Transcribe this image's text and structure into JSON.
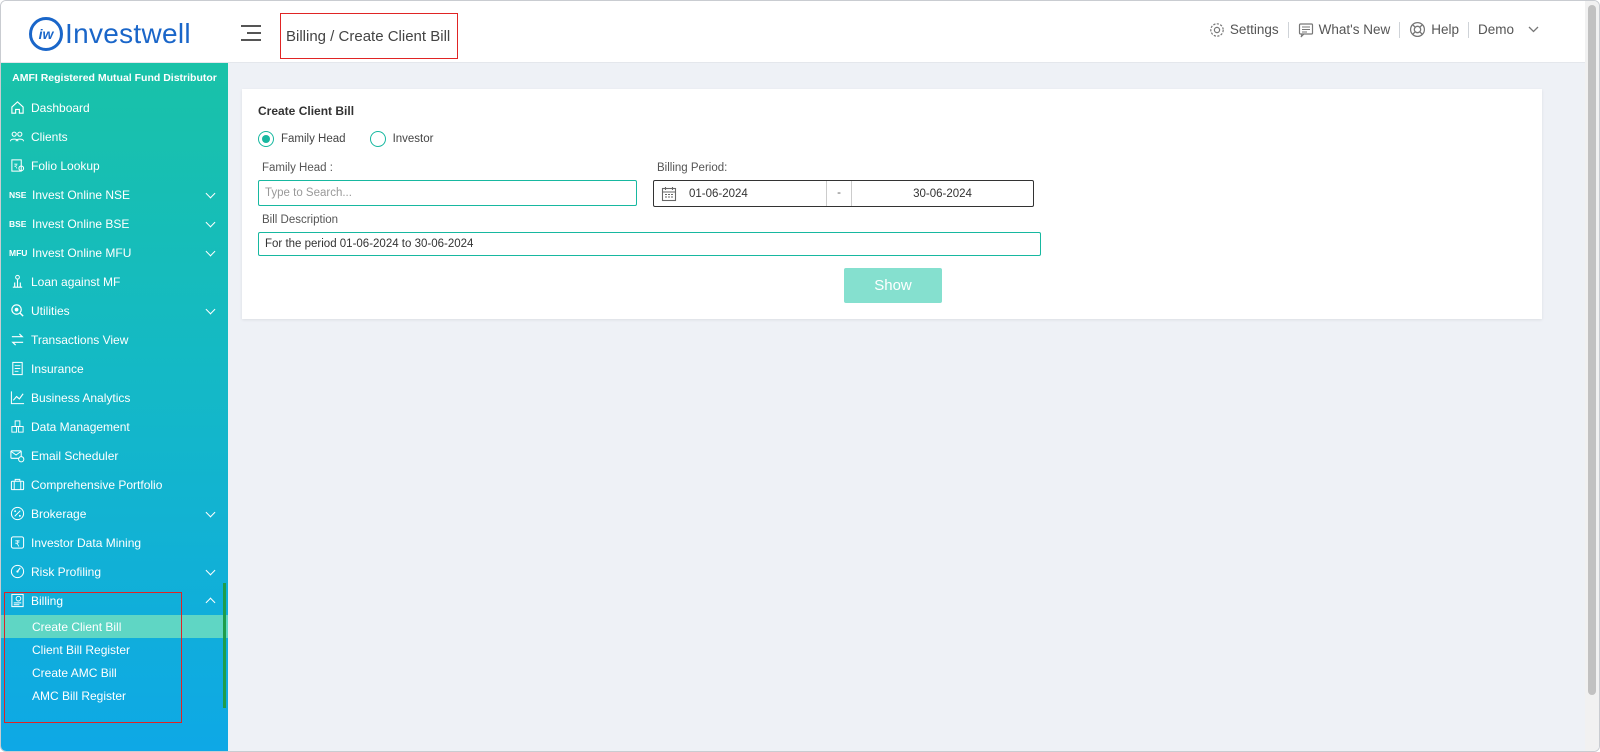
{
  "header": {
    "logo_text": "Investwell",
    "logo_mark": "iw",
    "breadcrumb": "Billing / Create Client Bill",
    "settings_label": "Settings",
    "whats_new_label": "What's New",
    "help_label": "Help",
    "user_label": "Demo"
  },
  "sidebar": {
    "amfi_label": "AMFI Registered Mutual Fund Distributor",
    "items": [
      {
        "label": "Dashboard",
        "icon": "home-icon"
      },
      {
        "label": "Clients",
        "icon": "clients-icon"
      },
      {
        "label": "Folio Lookup",
        "icon": "folio-icon"
      },
      {
        "label": "Invest Online NSE",
        "tag": "NSE",
        "expandable": true
      },
      {
        "label": "Invest Online BSE",
        "tag": "BSE",
        "expandable": true
      },
      {
        "label": "Invest Online MFU",
        "tag": "MFU",
        "expandable": true
      },
      {
        "label": "Loan against MF",
        "icon": "loan-icon"
      },
      {
        "label": "Utilities",
        "icon": "utilities-icon",
        "expandable": true
      },
      {
        "label": "Transactions View",
        "icon": "transfer-icon"
      },
      {
        "label": "Insurance",
        "icon": "insurance-icon"
      },
      {
        "label": "Business Analytics",
        "icon": "analytics-icon"
      },
      {
        "label": "Data Management",
        "icon": "data-icon"
      },
      {
        "label": "Email Scheduler",
        "icon": "email-icon"
      },
      {
        "label": "Comprehensive Portfolio",
        "icon": "briefcase-icon"
      },
      {
        "label": "Brokerage",
        "icon": "percent-icon",
        "expandable": true
      },
      {
        "label": "Investor Data Mining",
        "icon": "rupee-icon"
      },
      {
        "label": "Risk Profiling",
        "icon": "risk-icon",
        "expandable": true
      },
      {
        "label": "Billing",
        "icon": "billing-icon",
        "expanded": true
      }
    ],
    "billing_sub": [
      {
        "label": "Create Client Bill",
        "active": true
      },
      {
        "label": "Client Bill Register"
      },
      {
        "label": "Create AMC Bill"
      },
      {
        "label": "AMC Bill Register"
      }
    ]
  },
  "form": {
    "title": "Create Client Bill",
    "radio_family_head": "Family Head",
    "radio_investor": "Investor",
    "selected_radio": "Family Head",
    "family_head_label": "Family Head :",
    "family_head_placeholder": "Type to Search...",
    "billing_period_label": "Billing Period:",
    "date_from": "01-06-2024",
    "date_separator": "-",
    "date_to": "30-06-2024",
    "bill_description_label": "Bill Description",
    "bill_description_value": "For the period 01-06-2024 to 30-06-2024",
    "show_button": "Show"
  },
  "colors": {
    "brand_blue": "#1a66c9",
    "accent_teal": "#17b8a0",
    "button_disabled": "#85e0cf",
    "highlight_red": "#e02424"
  }
}
